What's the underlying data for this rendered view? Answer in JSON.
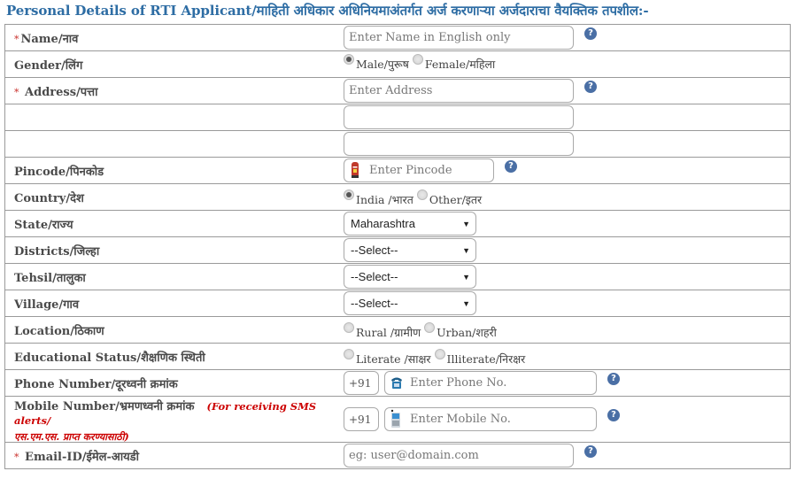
{
  "title": "Personal Details of RTI Applicant/माहिती अधिकार अधिनियमाअंतर्गत अर्ज करणाऱ्या अर्जदाराचा वैयक्तिक तपशील:-",
  "required_marker": "*",
  "help_glyph": "?",
  "colors": {
    "title": "#2e6da4",
    "required": "#c9302c",
    "note": "#cc0000",
    "help_icon": "#4a6fa5"
  },
  "fields": {
    "name": {
      "label": "Name/नाव",
      "placeholder": "Enter Name in English only",
      "required": true
    },
    "gender": {
      "label": "Gender/लिंग",
      "options": [
        {
          "label": "Male/पुरूष",
          "selected": true
        },
        {
          "label": "Female/महिला",
          "selected": false
        }
      ]
    },
    "address": {
      "label": "Address/पत्ता",
      "placeholder": "Enter Address",
      "line2": "",
      "line3": "",
      "required": true
    },
    "pincode": {
      "label": "Pincode/पिनकोड",
      "placeholder": "Enter Pincode",
      "icon": "postbox-icon"
    },
    "country": {
      "label": "Country/देश",
      "options": [
        {
          "label": "India /भारत",
          "selected": true
        },
        {
          "label": "Other/इतर",
          "selected": false
        }
      ]
    },
    "state": {
      "label": "State/राज्य",
      "value": "Maharashtra"
    },
    "district": {
      "label": "Districts/जिल्हा",
      "value": "--Select--"
    },
    "tehsil": {
      "label": "Tehsil/तालुका",
      "value": "--Select--"
    },
    "village": {
      "label": "Village/गाव",
      "value": "--Select--"
    },
    "location": {
      "label": "Location/ठिकाण",
      "options": [
        {
          "label": "Rural /ग्रामीण",
          "selected": false
        },
        {
          "label": "Urban/शहरी",
          "selected": false
        }
      ]
    },
    "education": {
      "label": "Educational Status/शैक्षणिक स्थिती",
      "options": [
        {
          "label": "Literate /साक्षर",
          "selected": false
        },
        {
          "label": "Illiterate/निरक्षर",
          "selected": false
        }
      ]
    },
    "phone": {
      "label": "Phone Number/दूरध्वनी क्रमांक",
      "country_code": "+91",
      "placeholder": "Enter Phone No.",
      "icon": "telephone-icon"
    },
    "mobile": {
      "label": "Mobile Number/भ्रमणध्वनी क्रमांक",
      "note_line1": "(For receiving SMS alerts/",
      "note_line2": "एस.एम.एस. प्राप्त करण्यासाठी)",
      "country_code": "+91",
      "placeholder": "Enter Mobile No.",
      "icon": "mobile-phone-icon"
    },
    "email": {
      "label": "Email-ID/ईमेल-आयडी",
      "placeholder": "eg: user@domain.com",
      "required": true
    }
  }
}
